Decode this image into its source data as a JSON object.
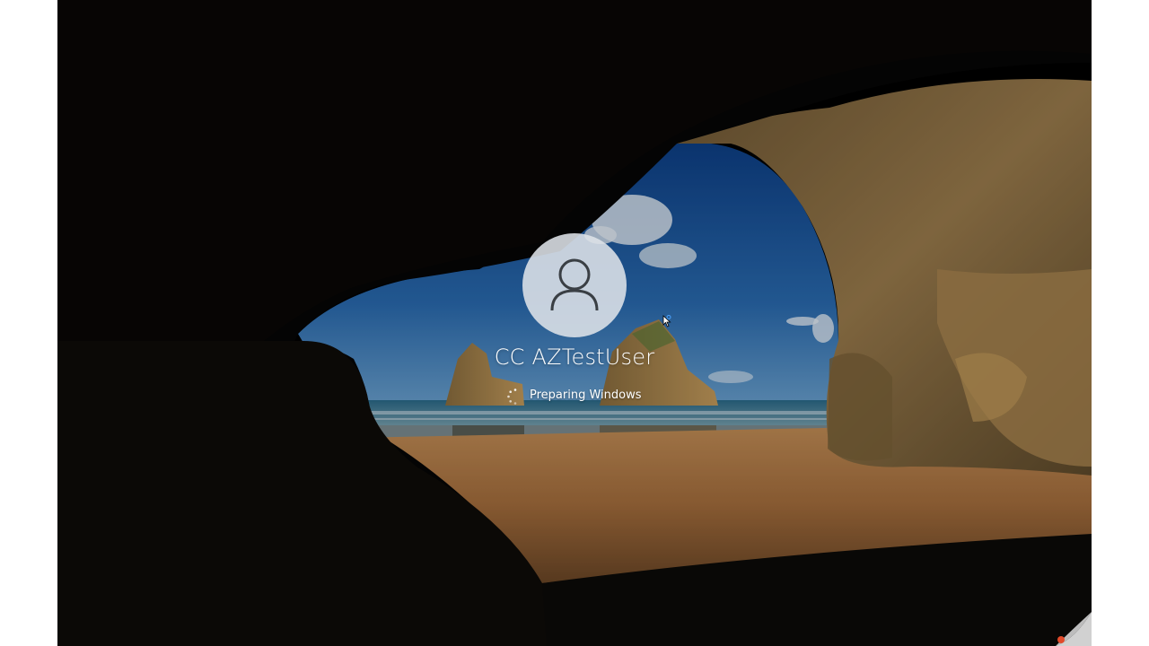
{
  "lock_screen": {
    "user": {
      "display_name": "CC AZTestUser",
      "avatar_icon": "user-silhouette-icon"
    },
    "status": {
      "text": "Preparing Windows",
      "icon": "loading-spinner-icon"
    }
  },
  "colors": {
    "text": "#ffffff",
    "avatar_bg": "#dee3e8",
    "avatar_glyph": "#3a3f44",
    "sky": "#1f5e9e",
    "sand": "#b98147",
    "rock": "#8d6e42"
  }
}
